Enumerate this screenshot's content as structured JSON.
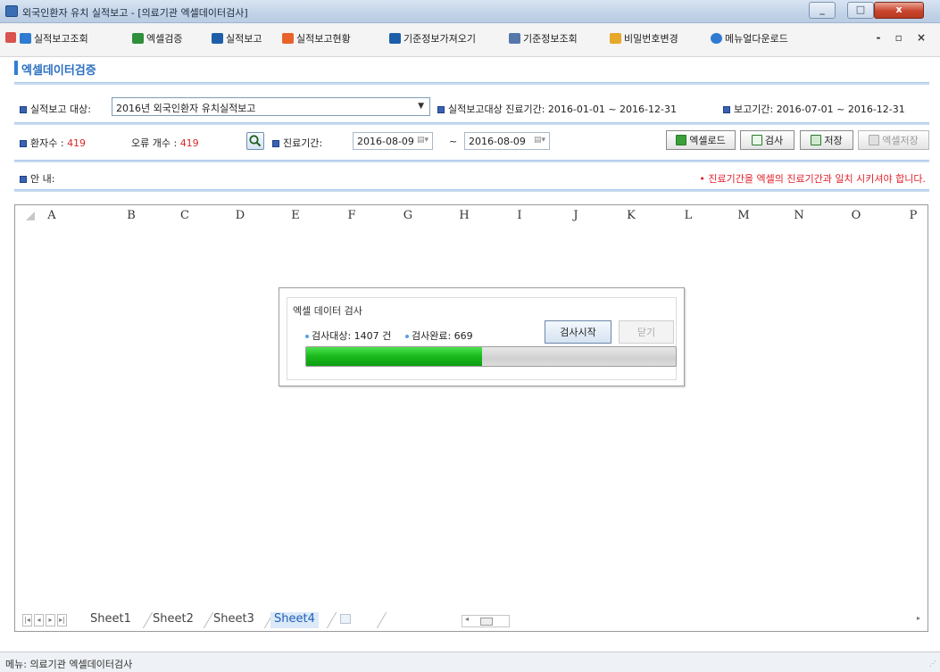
{
  "window": {
    "title": "외국인환자 유치 실적보고 - [의료기관 엑셀데이터검사]",
    "min_glyph": "_",
    "max_glyph": "□",
    "close_glyph": "x"
  },
  "menu": {
    "items": [
      {
        "label": "실적보고조회",
        "icon": "report-view-icon",
        "color": "#2e7bd1"
      },
      {
        "label": "엑셀검증",
        "icon": "excel-verify-icon",
        "color": "#2f8f3a"
      },
      {
        "label": "실적보고",
        "icon": "upload-arrow-icon",
        "color": "#1c5fa8"
      },
      {
        "label": "실적보고현황",
        "icon": "status-chart-icon",
        "color": "#e8632a"
      },
      {
        "label": "기준정보가져오기",
        "icon": "download-arrow-icon",
        "color": "#1c5fa8"
      },
      {
        "label": "기준정보조회",
        "icon": "search-doc-icon",
        "color": "#5577aa"
      },
      {
        "label": "비밀번호변경",
        "icon": "lock-icon",
        "color": "#e6a82a"
      },
      {
        "label": "메뉴얼다운로드",
        "icon": "help-icon",
        "color": "#2e7bd1"
      }
    ],
    "mdi_controls": "- ▫ ×"
  },
  "page": {
    "title": "엑셀데이터검증"
  },
  "form": {
    "report_target_label": "실적보고 대상:",
    "report_target_value": "2016년 외국인환자 유치실적보고",
    "treat_period_label": "실적보고대상 진료기간:",
    "treat_period_value": "2016-01-01 ~ 2016-12-31",
    "report_period_label": "보고기간:",
    "report_period_value": "2016-07-01 ~ 2016-12-31",
    "patients_label": "환자수 :",
    "patients_value": "419",
    "errors_label": "오류 개수 :",
    "errors_value": "419",
    "treat_range_label": "진료기간:",
    "date_from": "2016-08-09",
    "date_to": "2016-08-09",
    "tilde": "~",
    "notice_label": "안 내:",
    "notice_text": "• 진료기간을 엑셀의 진료기간과 일치 시키셔야 합니다."
  },
  "toolbar": {
    "excel_load": "엑셀로드",
    "check": "검사",
    "save": "저장",
    "excel_save": "엑셀저장"
  },
  "sheet": {
    "columns": [
      "A",
      "B",
      "C",
      "D",
      "E",
      "F",
      "G",
      "H",
      "I",
      "J",
      "K",
      "L",
      "M",
      "N",
      "O",
      "P"
    ],
    "tabs": [
      "Sheet1",
      "Sheet2",
      "Sheet3",
      "Sheet4"
    ],
    "active_tab": "Sheet4"
  },
  "dialog": {
    "title": "엑셀 데이터 검사",
    "target_label": "검사대상: 1407 건",
    "done_label": "검사완료: 669",
    "start_button": "검사시작",
    "close_button": "닫기",
    "progress_fraction": 0.4755
  },
  "status": {
    "text": "메뉴: 의료기관 엑셀데이터검사"
  }
}
